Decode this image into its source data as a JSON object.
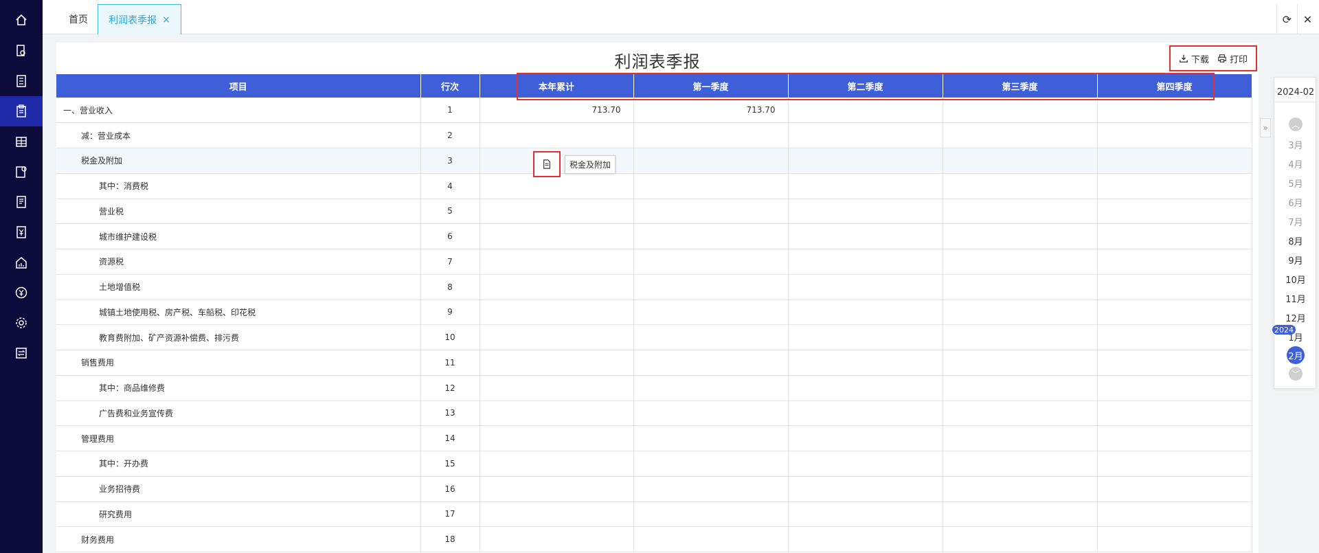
{
  "nav": {
    "items": [
      {
        "icon": "home-icon",
        "active": false
      },
      {
        "icon": "document-search-icon",
        "active": false
      },
      {
        "icon": "ledger-icon",
        "active": false
      },
      {
        "icon": "clipboard-report-icon",
        "active": true
      },
      {
        "icon": "building-columns-icon",
        "active": false
      },
      {
        "icon": "document-gear-icon",
        "active": false
      },
      {
        "icon": "report-list-icon",
        "active": false
      },
      {
        "icon": "yen-document-icon",
        "active": false
      },
      {
        "icon": "house-chart-icon",
        "active": false
      },
      {
        "icon": "yen-circle-icon",
        "active": false
      },
      {
        "icon": "settings-icon",
        "active": false
      },
      {
        "icon": "transfer-icon",
        "active": false
      }
    ]
  },
  "tabs": {
    "home": "首页",
    "active": "利润表季报",
    "close": "×"
  },
  "toolbar": {
    "refresh_icon": "refresh-icon",
    "close_icon": "close-icon"
  },
  "page": {
    "title": "利润表季报",
    "download_label": "下载",
    "print_label": "打印",
    "expand_icon": "»"
  },
  "table": {
    "columns": [
      "项目",
      "行次",
      "本年累计",
      "第一季度",
      "第二季度",
      "第三季度",
      "第四季度"
    ],
    "rows": [
      {
        "item": "一、营业收入",
        "line": "1",
        "ytd": "713.70",
        "q1": "713.70",
        "q2": "",
        "q3": "",
        "q4": "",
        "indent": 0
      },
      {
        "item": "减：营业成本",
        "line": "2",
        "ytd": "",
        "q1": "",
        "q2": "",
        "q3": "",
        "q4": "",
        "indent": 1
      },
      {
        "item": "税金及附加",
        "line": "3",
        "ytd": "",
        "q1": "",
        "q2": "",
        "q3": "",
        "q4": "",
        "indent": 1
      },
      {
        "item": "其中：消费税",
        "line": "4",
        "ytd": "",
        "q1": "",
        "q2": "",
        "q3": "",
        "q4": "",
        "indent": 2
      },
      {
        "item": "营业税",
        "line": "5",
        "ytd": "",
        "q1": "",
        "q2": "",
        "q3": "",
        "q4": "",
        "indent": 2
      },
      {
        "item": "城市维护建设税",
        "line": "6",
        "ytd": "",
        "q1": "",
        "q2": "",
        "q3": "",
        "q4": "",
        "indent": 2
      },
      {
        "item": "资源税",
        "line": "7",
        "ytd": "",
        "q1": "",
        "q2": "",
        "q3": "",
        "q4": "",
        "indent": 2
      },
      {
        "item": "土地增值税",
        "line": "8",
        "ytd": "",
        "q1": "",
        "q2": "",
        "q3": "",
        "q4": "",
        "indent": 2
      },
      {
        "item": "城镇土地使用税、房产税、车船税、印花税",
        "line": "9",
        "ytd": "",
        "q1": "",
        "q2": "",
        "q3": "",
        "q4": "",
        "indent": 2
      },
      {
        "item": "教育费附加、矿产资源补偿费、排污费",
        "line": "10",
        "ytd": "",
        "q1": "",
        "q2": "",
        "q3": "",
        "q4": "",
        "indent": 2
      },
      {
        "item": "销售费用",
        "line": "11",
        "ytd": "",
        "q1": "",
        "q2": "",
        "q3": "",
        "q4": "",
        "indent": 1
      },
      {
        "item": "其中：商品维修费",
        "line": "12",
        "ytd": "",
        "q1": "",
        "q2": "",
        "q3": "",
        "q4": "",
        "indent": 2
      },
      {
        "item": "广告费和业务宣传费",
        "line": "13",
        "ytd": "",
        "q1": "",
        "q2": "",
        "q3": "",
        "q4": "",
        "indent": 2
      },
      {
        "item": "管理费用",
        "line": "14",
        "ytd": "",
        "q1": "",
        "q2": "",
        "q3": "",
        "q4": "",
        "indent": 1
      },
      {
        "item": "其中：开办费",
        "line": "15",
        "ytd": "",
        "q1": "",
        "q2": "",
        "q3": "",
        "q4": "",
        "indent": 2
      },
      {
        "item": "业务招待费",
        "line": "16",
        "ytd": "",
        "q1": "",
        "q2": "",
        "q3": "",
        "q4": "",
        "indent": 2
      },
      {
        "item": "研究费用",
        "line": "17",
        "ytd": "",
        "q1": "",
        "q2": "",
        "q3": "",
        "q4": "",
        "indent": 2
      },
      {
        "item": "财务费用",
        "line": "18",
        "ytd": "",
        "q1": "",
        "q2": "",
        "q3": "",
        "q4": "",
        "indent": 1
      }
    ],
    "tooltip": "税金及附加"
  },
  "period_panel": {
    "current": "2024-02",
    "year_badge": "2024",
    "months": [
      "3月",
      "4月",
      "5月",
      "6月",
      "7月",
      "8月",
      "9月",
      "10月",
      "11月",
      "12月",
      "1月",
      "2月"
    ],
    "dim_months": [
      "3月",
      "4月",
      "5月",
      "6月",
      "7月"
    ],
    "selected": "2月"
  },
  "colors": {
    "sidebar_bg": "#0c0b3c",
    "sidebar_active": "#1f2aa8",
    "header_blue": "#3f5fd8",
    "tab_accent": "#2aa4d8",
    "annotation_red": "#e52e2e"
  }
}
